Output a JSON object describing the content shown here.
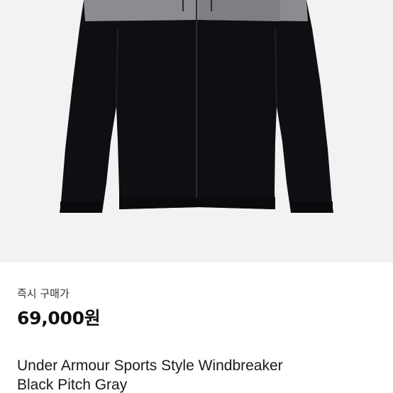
{
  "listing": {
    "sale_type_label": "즉시 구매가",
    "price": "69,000원",
    "title_line_1": "Under Armour Sports Style Windbreaker",
    "title_line_2": "Black Pitch Gray"
  },
  "colors": {
    "image_background": "#f2f2f2",
    "jacket_black": "#0e0f12",
    "jacket_gray_panel": "#8a8c8f",
    "page_background": "#ffffff"
  },
  "icons": {
    "product_image": "black-windbreaker-jacket-photo"
  }
}
